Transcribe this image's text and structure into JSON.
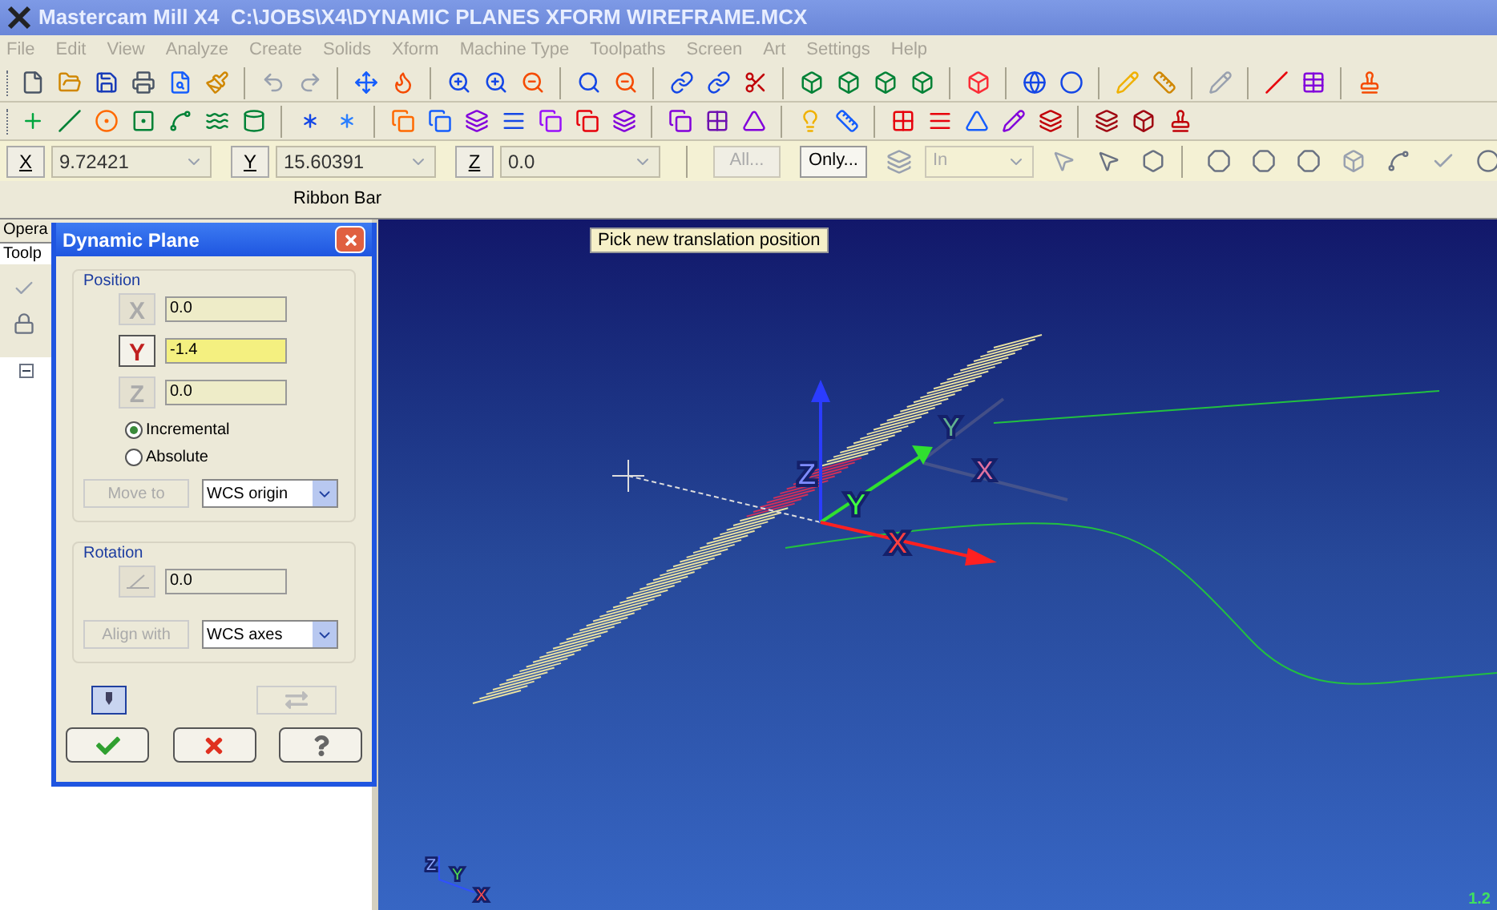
{
  "window": {
    "title": "Mastercam Mill X4  C:\\JOBS\\X4\\DYNAMIC PLANES XFORM WIREFRAME.MCX"
  },
  "menu": [
    {
      "label": "File",
      "disabled": true
    },
    {
      "label": "Edit",
      "disabled": true
    },
    {
      "label": "View",
      "disabled": true
    },
    {
      "label": "Analyze",
      "disabled": true
    },
    {
      "label": "Create",
      "disabled": true
    },
    {
      "label": "Solids",
      "disabled": true
    },
    {
      "label": "Xform",
      "disabled": true
    },
    {
      "label": "Machine Type",
      "disabled": true
    },
    {
      "label": "Toolpaths",
      "disabled": true
    },
    {
      "label": "Screen",
      "disabled": true
    },
    {
      "label": "Art",
      "disabled": true
    },
    {
      "label": "Settings",
      "disabled": true
    },
    {
      "label": "Help",
      "disabled": true
    }
  ],
  "ribbon": {
    "coords": [
      {
        "axis": "X",
        "value": "9.72421"
      },
      {
        "axis": "Y",
        "value": "15.60391"
      },
      {
        "axis": "Z",
        "value": "0.0"
      }
    ],
    "buttons": [
      {
        "label": "All...",
        "disabled": true
      },
      {
        "label": "Only...",
        "disabled": false
      }
    ],
    "mask_select": {
      "value": "In",
      "disabled": true
    },
    "caption": "Ribbon Bar"
  },
  "manager": {
    "tabs": [
      {
        "label": "Opera",
        "selected": false
      },
      {
        "label": "Toolp",
        "selected": true
      }
    ]
  },
  "dialog": {
    "title": "Dynamic Plane",
    "position": {
      "title": "Position",
      "axes": [
        {
          "label": "X",
          "selected": false,
          "value": "0.0"
        },
        {
          "label": "Y",
          "selected": true,
          "value": "-1.4"
        },
        {
          "label": "Z",
          "selected": false,
          "value": "0.0"
        }
      ],
      "modes": [
        {
          "label": "Incremental",
          "selected": true
        },
        {
          "label": "Absolute",
          "selected": false
        }
      ],
      "move_to": {
        "label": "Move to",
        "disabled": true
      },
      "origin_select": "WCS origin"
    },
    "rotation": {
      "title": "Rotation",
      "value": "0.0",
      "align_with": {
        "label": "Align with",
        "disabled": true
      },
      "axes_select": "WCS axes"
    }
  },
  "viewport": {
    "tooltip": "Pick new translation position",
    "gizmo_labels": [
      {
        "kind": "ghost_y",
        "text": "Y"
      },
      {
        "kind": "z",
        "text": "Z"
      },
      {
        "kind": "ghost_x",
        "text": "X"
      },
      {
        "kind": "y",
        "text": "Y"
      },
      {
        "kind": "x",
        "text": "X"
      }
    ],
    "view_axes": [
      {
        "kind": "z",
        "text": "Z"
      },
      {
        "kind": "y",
        "text": "Y"
      },
      {
        "kind": "x",
        "text": "X"
      }
    ],
    "corner_text": "1.2"
  }
}
